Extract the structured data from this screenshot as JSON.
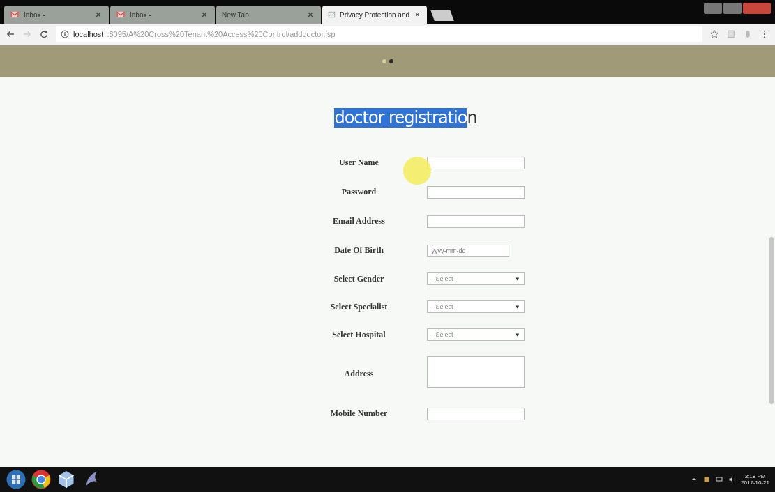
{
  "browser": {
    "tabs": [
      {
        "kind": "mail",
        "label": "Inbox - ",
        "selected": false
      },
      {
        "kind": "mail",
        "label": "Inbox - ",
        "selected": false
      },
      {
        "kind": "page",
        "label": "New Tab",
        "selected": false
      },
      {
        "kind": "doc",
        "label": "Privacy Protection and",
        "selected": true
      }
    ],
    "url_host": "localhost",
    "url_path": ":8095/A%20Cross%20Tenant%20Access%20Control/adddoctor.jsp"
  },
  "banner": {
    "dots": [
      {
        "selected": false
      },
      {
        "selected": true
      }
    ]
  },
  "heading": {
    "highlighted": "doctor registratio",
    "plain": "n"
  },
  "form": [
    {
      "label": "User Name",
      "kind": "text"
    },
    {
      "label": "Password",
      "kind": "text"
    },
    {
      "label": "Email Address",
      "kind": "text"
    },
    {
      "label": "Date Of Birth",
      "kind": "date",
      "placeholder": "yyyy-mm-dd"
    },
    {
      "label": "Select Gender",
      "kind": "select",
      "value": "--Select--"
    },
    {
      "label": "Select Specialist",
      "kind": "select",
      "value": "--Select--"
    },
    {
      "label": "Select Hospital",
      "kind": "select",
      "value": "--Select--"
    },
    {
      "label": "Address",
      "kind": "textarea"
    },
    {
      "label": "Mobile Number",
      "kind": "text"
    }
  ],
  "taskbar": {
    "time": "3:18 PM",
    "date": "2017-10-21"
  }
}
